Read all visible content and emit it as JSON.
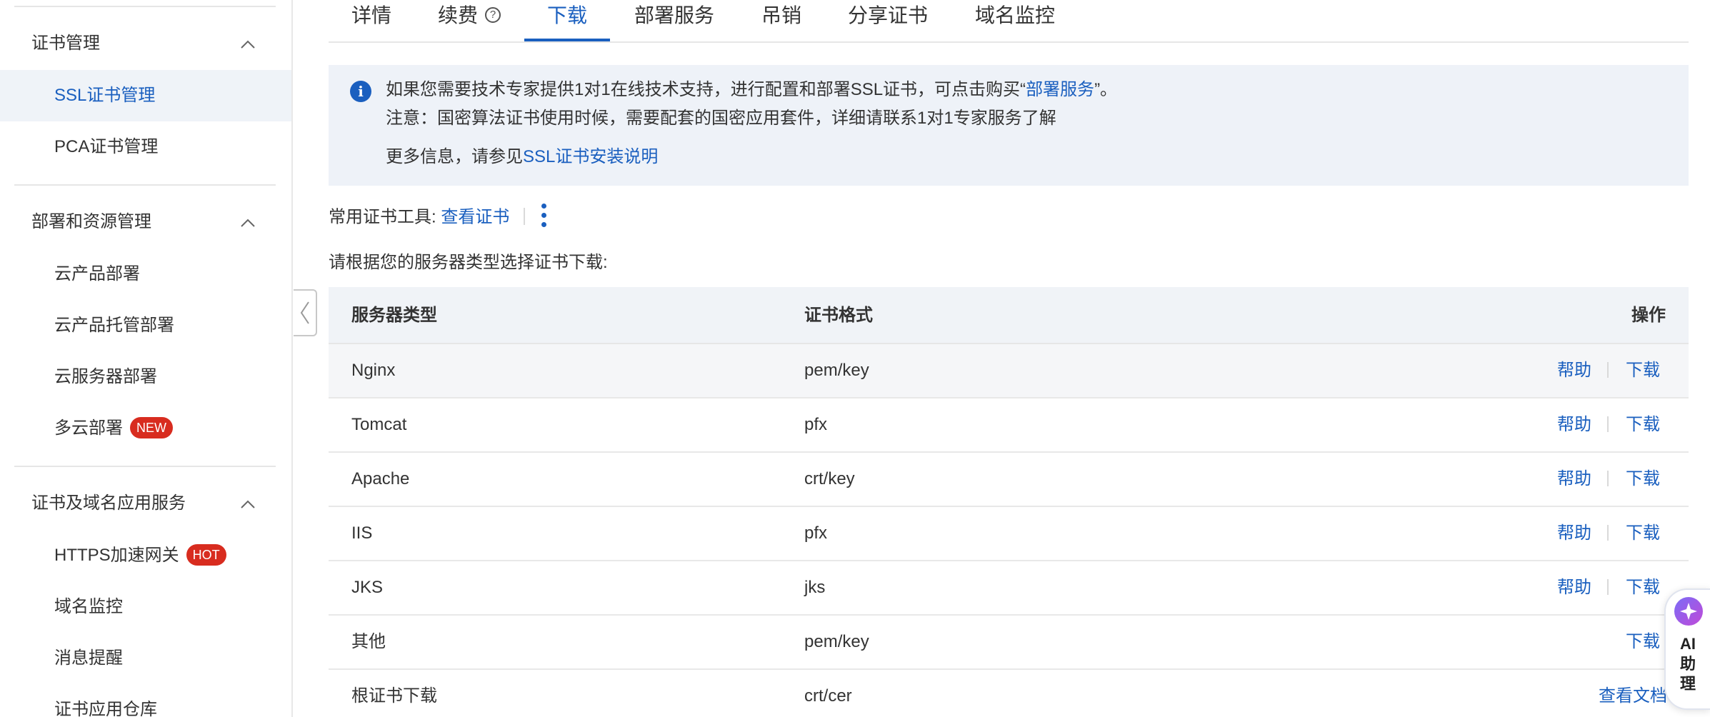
{
  "sidebar": {
    "groups": [
      {
        "label": "证书管理",
        "items": [
          {
            "label": "SSL证书管理",
            "active": true
          },
          {
            "label": "PCA证书管理"
          }
        ]
      },
      {
        "label": "部署和资源管理",
        "items": [
          {
            "label": "云产品部署"
          },
          {
            "label": "云产品托管部署"
          },
          {
            "label": "云服务器部署"
          },
          {
            "label": "多云部署",
            "badge": "NEW"
          }
        ]
      },
      {
        "label": "证书及域名应用服务",
        "items": [
          {
            "label": "HTTPS加速网关",
            "badge": "HOT"
          },
          {
            "label": "域名监控"
          },
          {
            "label": "消息提醒"
          },
          {
            "label": "证书应用仓库"
          }
        ]
      }
    ]
  },
  "tabs": [
    {
      "label": "详情"
    },
    {
      "label": "续费",
      "help_icon": "?"
    },
    {
      "label": "下载",
      "active": true
    },
    {
      "label": "部署服务"
    },
    {
      "label": "吊销"
    },
    {
      "label": "分享证书"
    },
    {
      "label": "域名监控"
    }
  ],
  "notice": {
    "icon": "i",
    "line1_prefix": "如果您需要技术专家提供1对1在线技术支持，进行配置和部署SSL证书，可点击购买“",
    "line1_link": "部署服务",
    "line1_suffix": "”。",
    "line2": "注意：国密算法证书使用时候，需要配套的国密应用套件，详细请联系1对1专家服务了解",
    "line3_prefix": "更多信息，请参见",
    "line3_link": "SSL证书安装说明"
  },
  "tools": {
    "label": "常用证书工具:",
    "link": "查看证书"
  },
  "hint": "请根据您的服务器类型选择证书下载:",
  "table": {
    "headers": {
      "server": "服务器类型",
      "format": "证书格式",
      "ops": "操作"
    },
    "rows": [
      {
        "server": "Nginx",
        "format": "pem/key",
        "help": "帮助",
        "action": "下载"
      },
      {
        "server": "Tomcat",
        "format": "pfx",
        "help": "帮助",
        "action": "下载"
      },
      {
        "server": "Apache",
        "format": "crt/key",
        "help": "帮助",
        "action": "下载"
      },
      {
        "server": "IIS",
        "format": "pfx",
        "help": "帮助",
        "action": "下载"
      },
      {
        "server": "JKS",
        "format": "jks",
        "help": "帮助",
        "action": "下载"
      },
      {
        "server": "其他",
        "format": "pem/key",
        "action": "下载"
      },
      {
        "server": "根证书下载",
        "format": "crt/cer",
        "action": "查看文档"
      }
    ]
  },
  "ai_assistant": {
    "label": "AI\n助\n理",
    "logo_icon": "sparkle-icon"
  },
  "colors": {
    "accent": "#1a5fbf",
    "badge": "#d82c1f",
    "notice_bg": "#eef2f8"
  }
}
